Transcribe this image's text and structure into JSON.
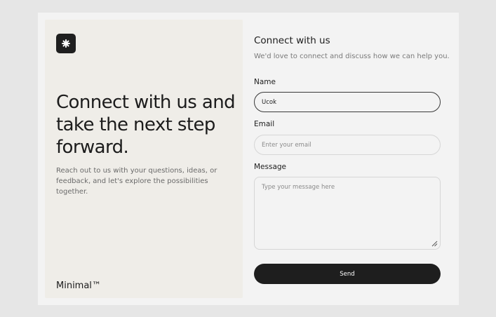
{
  "hero": {
    "headline": "Connect with us and take the next step forward.",
    "description": "Reach out to us with your questions, ideas, or feedback, and let's explore the possibilities together.",
    "brand": "Minimal™",
    "logo_icon": "asterisk-icon"
  },
  "form": {
    "title": "Connect with us",
    "subtitle": "We'd love to connect and discuss how we can help you.",
    "name": {
      "label": "Name",
      "value": "Ucok",
      "placeholder": ""
    },
    "email": {
      "label": "Email",
      "value": "",
      "placeholder": "Enter your email"
    },
    "message": {
      "label": "Message",
      "value": "",
      "placeholder": "Type your message here"
    },
    "send_label": "Send"
  },
  "colors": {
    "page_background": "#e6e6e6",
    "card_background": "#f3f3f3",
    "hero_background": "#efede8",
    "accent_dark": "#1e1e1e"
  }
}
